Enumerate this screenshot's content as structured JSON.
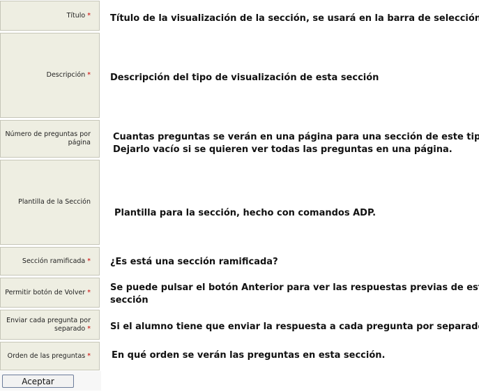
{
  "required_mark": "*",
  "fields": {
    "titulo": {
      "label": "Título",
      "description": "Título de la visualización de la sección, se usará en la barra de selección."
    },
    "descripcion": {
      "label": "Descripción",
      "description": "Descripción del tipo de visualización de esta sección"
    },
    "num_preguntas": {
      "label_line1": "Número de preguntas por",
      "label_line2": "página",
      "description_line1": "Cuantas preguntas se verán en una página para una sección de este tipo.",
      "description_line2": "Dejarlo vacío si se quieren ver todas las preguntas en una página."
    },
    "plantilla": {
      "label": "Plantilla de la Sección",
      "description": "Plantilla para la sección, hecho con comandos ADP."
    },
    "ramificada": {
      "label": "Sección ramificada",
      "description": "¿Es está una sección ramificada?"
    },
    "boton_volver": {
      "label": "Permitir botón de Volver",
      "description_line1": "Se puede pulsar el botón Anterior para ver las respuestas previas de esta",
      "description_line2": "sección"
    },
    "enviar_separado": {
      "label_line1": "Enviar cada pregunta por",
      "label_line2": "separado",
      "description": "Si el alumno tiene que enviar la respuesta a cada pregunta por separado."
    },
    "orden": {
      "label": "Orden de las preguntas",
      "description": "En qué orden se verán las preguntas en esta sección."
    }
  },
  "submit_label": "Aceptar"
}
